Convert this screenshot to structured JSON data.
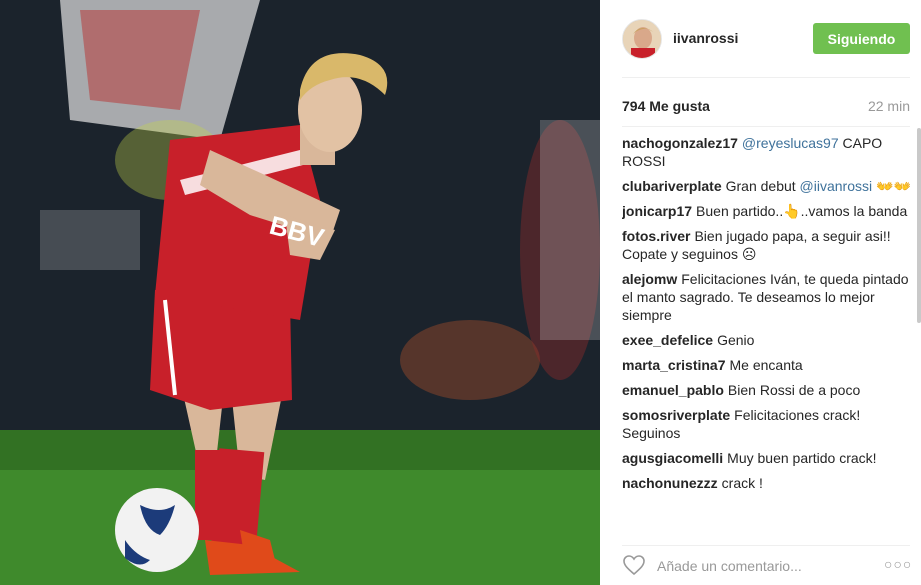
{
  "post": {
    "username": "iivanrossi",
    "follow_label": "Siguiendo",
    "likes": "794 Me gusta",
    "time": "22 min",
    "comment_placeholder": "Añade un comentario...",
    "more_label": "○○○"
  },
  "comments": [
    {
      "user": "nachogonzalez17",
      "mention": "@reyeslucas97",
      "text": " CAPO ROSSI"
    },
    {
      "user": "clubariverplate",
      "text": "Gran debut ",
      "mention": "@iivanrossi",
      "tail": " 👐👐"
    },
    {
      "user": "jonicarp17",
      "text": "Buen partido..👆..vamos la banda"
    },
    {
      "user": "fotos.river",
      "text": "Bien jugado papa, a seguir asi!! Copate y seguinos ☹"
    },
    {
      "user": "alejomw",
      "text": "Felicitaciones Iván, te queda pintado el manto sagrado. Te deseamos lo mejor siempre"
    },
    {
      "user": "exee_defelice",
      "text": "Genio"
    },
    {
      "user": "marta_cristina7",
      "text": "Me encanta"
    },
    {
      "user": "emanuel_pablo",
      "text": "Bien Rossi de a poco"
    },
    {
      "user": "somosriverplate",
      "text": "Felicitaciones crack! Seguinos"
    },
    {
      "user": "agusgiacomelli",
      "text": "Muy buen partido crack!"
    },
    {
      "user": "nachonunezzz",
      "text": "crack !"
    }
  ],
  "photo": {
    "shirt_text": "BBV"
  },
  "colors": {
    "follow_bg": "#70c050",
    "mention": "#3f729b",
    "shirt_red": "#c8202a"
  }
}
